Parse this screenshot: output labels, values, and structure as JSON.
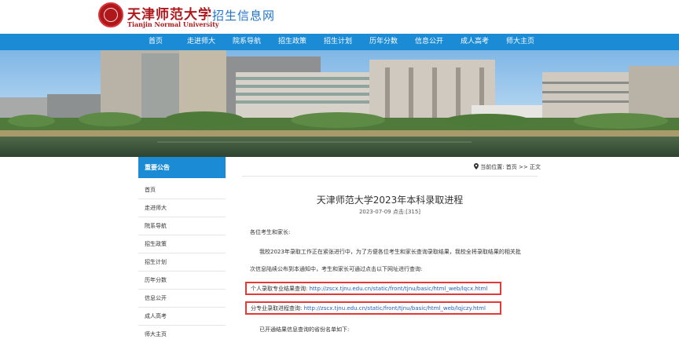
{
  "header": {
    "logo_cn": "天津师范大学",
    "logo_en": "Tianjin Normal University",
    "site_name": "招生信息网"
  },
  "nav": {
    "items": [
      "首页",
      "走进师大",
      "院系导航",
      "招生政策",
      "招生计划",
      "历年分数",
      "信息公开",
      "成人高考",
      "师大主页"
    ]
  },
  "sidebar": {
    "title": "重要公告",
    "items": [
      "首页",
      "走进师大",
      "院系导航",
      "招生政策",
      "招生计划",
      "历年分数",
      "信息公开",
      "成人高考",
      "师大主页"
    ]
  },
  "breadcrumb": {
    "prefix": "当前位置:",
    "home": "首页",
    "sep": ">>",
    "current": "正文"
  },
  "article": {
    "title": "天津师范大学2023年本科录取进程",
    "date": "2023-07-09",
    "hits_label": "点击:",
    "hits": "[315]",
    "greeting": "各位考生和家长:",
    "para1": "我校2023年录取工作正在紧张进行中，为了方便各位考生和家长查询录取结果，我校全将录取结果的相关批",
    "para2": "次信息陆续公布到本通知中，考生和家长可通过点击以下网址进行查询:",
    "link1_label": "个人录取专业结果查询:",
    "link1_url": "http://zscx.tjnu.edu.cn/static/front/tjnu/basic/html_web/lqcx.html",
    "link2_label": "分专业录取进程查询:",
    "link2_url": "http://zscx.tjnu.edu.cn/static/front/tjnu/basic/html_web/lqjczy.html",
    "para3": "已开通结果信息查询的省份名单如下:"
  },
  "colors": {
    "brand_red": "#b0171b",
    "nav_blue": "#1b8bd6",
    "link_blue": "#1f5fbf",
    "highlight_red": "#e53935"
  }
}
